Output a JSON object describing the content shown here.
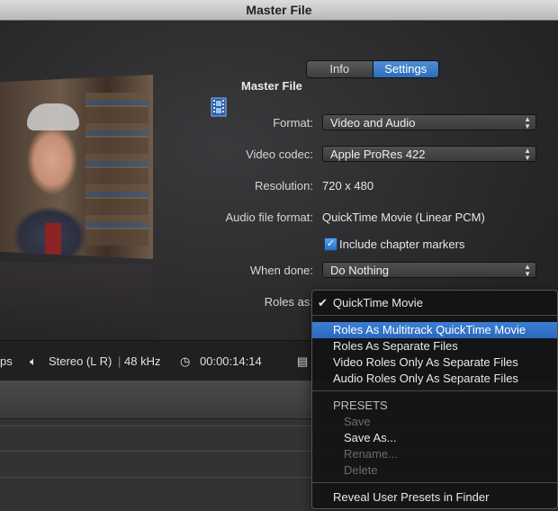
{
  "window": {
    "title": "Master File"
  },
  "tabs": [
    {
      "label": "Info",
      "selected": false
    },
    {
      "label": "Settings",
      "selected": true
    }
  ],
  "header": {
    "title": "Master File",
    "icon": "film-file-icon"
  },
  "fields": {
    "format": {
      "label": "Format:",
      "value": "Video and Audio"
    },
    "video_codec": {
      "label": "Video codec:",
      "value": "Apple ProRes 422"
    },
    "resolution": {
      "label": "Resolution:",
      "value": "720 x 480"
    },
    "audio_format": {
      "label": "Audio file format:",
      "value": "QuickTime Movie (Linear PCM)"
    },
    "chapter_markers": {
      "label": "Include chapter markers",
      "checked": true
    },
    "when_done": {
      "label": "When done:",
      "value": "Do Nothing"
    },
    "roles_as": {
      "label": "Roles as:"
    }
  },
  "status_bar": {
    "left_fragment": "ps",
    "audio": "Stereo (L R)",
    "sample_rate": "48 kHz",
    "duration": "00:00:14:14"
  },
  "roles_menu": {
    "checked_item": "QuickTime Movie",
    "items": [
      "Roles As Multitrack QuickTime Movie",
      "Roles As Separate Files",
      "Video Roles Only As Separate Files",
      "Audio Roles Only As Separate Files"
    ],
    "highlighted_index": 0,
    "presets_header": "PRESETS",
    "presets": [
      {
        "label": "Save",
        "enabled": false
      },
      {
        "label": "Save As...",
        "enabled": true
      },
      {
        "label": "Rename...",
        "enabled": false
      },
      {
        "label": "Delete",
        "enabled": false
      }
    ],
    "footer": "Reveal User Presets in Finder"
  },
  "colors": {
    "accent": "#2d6bb8",
    "highlight": "#3d7fd4"
  }
}
